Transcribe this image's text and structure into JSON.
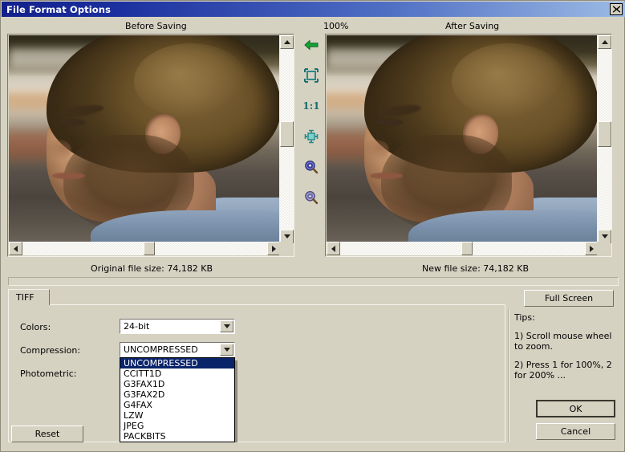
{
  "window": {
    "title": "File Format Options",
    "close_icon": "close-icon"
  },
  "preview": {
    "before_label": "Before Saving",
    "after_label": "After Saving",
    "zoom_level": "100%",
    "original_file_size": "Original file size:  74,182 KB",
    "new_file_size": "New file size:  74,182 KB"
  },
  "toolbar": {
    "items": [
      {
        "name": "back-arrow-icon",
        "label": ""
      },
      {
        "name": "fit-to-window-icon",
        "label": ""
      },
      {
        "name": "actual-size-icon",
        "label": "1:1"
      },
      {
        "name": "fit-width-icon",
        "label": ""
      },
      {
        "name": "zoom-in-icon",
        "label": ""
      },
      {
        "name": "zoom-out-icon",
        "label": ""
      }
    ],
    "actual_size_label": "1:1"
  },
  "tabs": [
    {
      "label": "TIFF",
      "selected": true
    }
  ],
  "options": {
    "colors": {
      "label": "Colors:",
      "value": "24-bit"
    },
    "compression": {
      "label": "Compression:",
      "value": "UNCOMPRESSED",
      "open": true,
      "items": [
        "UNCOMPRESSED",
        "CCITT1D",
        "G3FAX1D",
        "G3FAX2D",
        "G4FAX",
        "LZW",
        "JPEG",
        "PACKBITS"
      ],
      "selected_index": 0
    },
    "photometric": {
      "label": "Photometric:"
    }
  },
  "tips": {
    "heading": "Tips:",
    "lines": [
      "1) Scroll mouse wheel to zoom.",
      "2) Press 1 for 100%, 2 for 200% ..."
    ]
  },
  "buttons": {
    "reset": "Reset",
    "full_screen": "Full Screen",
    "ok": "OK",
    "cancel": "Cancel"
  },
  "colors": {
    "title_bar_start": "#12208c",
    "title_bar_end": "#9dbbe4",
    "dialog_face": "#d6d2c2",
    "selection_blue": "#0a246a",
    "tool_teal": "#1b6b6b",
    "arrow_green": "#1f9e3c"
  }
}
